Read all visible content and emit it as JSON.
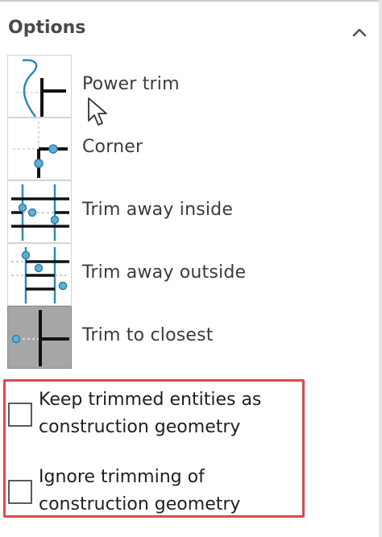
{
  "panel": {
    "title": "Options",
    "collapse_icon": "chevron-up-icon"
  },
  "options": [
    {
      "label": "Power trim",
      "icon": "power-trim-icon"
    },
    {
      "label": "Corner",
      "icon": "corner-icon"
    },
    {
      "label": "Trim away inside",
      "icon": "trim-away-inside-icon"
    },
    {
      "label": "Trim away outside",
      "icon": "trim-away-outside-icon"
    },
    {
      "label": "Trim to closest",
      "icon": "trim-to-closest-icon",
      "selected": true
    }
  ],
  "checkboxes": [
    {
      "label_line1": "Keep trimmed entities as",
      "label_line2": "construction geometry",
      "checked": false
    },
    {
      "label_line1": "Ignore trimming of",
      "label_line2": "construction geometry",
      "checked": false
    }
  ],
  "colors": {
    "accent_blue": "#2e8bb8",
    "highlight_red": "#e0474c",
    "selected_bg": "#a6a6a6"
  }
}
